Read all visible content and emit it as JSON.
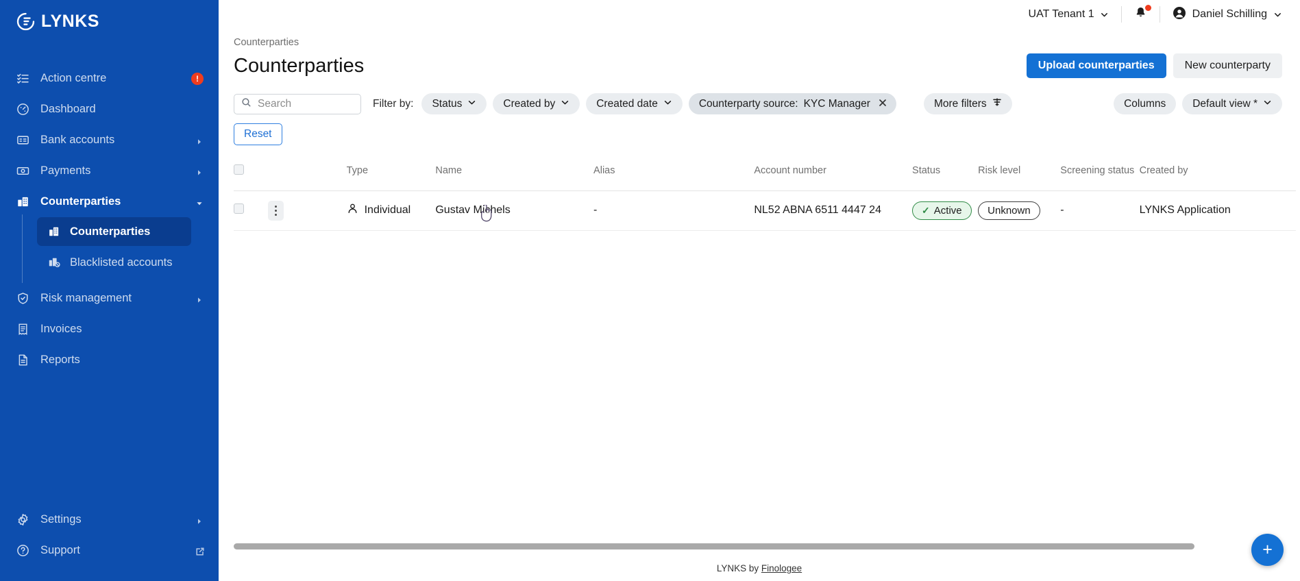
{
  "brand": {
    "name": "LYNKS",
    "logo_icon": "lynks-logo-icon",
    "accent": "#1471d4",
    "sidebar_bg": "#0d4eae",
    "sidebar_active_bg": "#0a3d8f"
  },
  "sidebar": {
    "items": [
      {
        "label": "Action centre",
        "icon": "action-list-icon",
        "badge": "!",
        "has_arrow": false
      },
      {
        "label": "Dashboard",
        "icon": "dashboard-gauge-icon",
        "has_arrow": false
      },
      {
        "label": "Bank accounts",
        "icon": "bank-card-icon",
        "has_arrow": true
      },
      {
        "label": "Payments",
        "icon": "banknote-icon",
        "has_arrow": true
      },
      {
        "label": "Counterparties",
        "icon": "building-icon",
        "has_arrow": true,
        "expanded": true
      },
      {
        "label": "Risk management",
        "icon": "shield-check-icon",
        "has_arrow": true
      },
      {
        "label": "Invoices",
        "icon": "invoice-icon",
        "has_arrow": false
      },
      {
        "label": "Reports",
        "icon": "document-icon",
        "has_arrow": false
      }
    ],
    "subitems": [
      {
        "label": "Counterparties",
        "icon": "building-icon",
        "selected": true
      },
      {
        "label": "Blacklisted accounts",
        "icon": "building-blocked-icon",
        "selected": false
      }
    ],
    "bottom_items": [
      {
        "label": "Settings",
        "icon": "gear-icon",
        "has_arrow": true
      },
      {
        "label": "Support",
        "icon": "help-circle-icon",
        "external": true,
        "external_icon": "external-link-icon"
      }
    ]
  },
  "topbar": {
    "tenant": "UAT Tenant 1",
    "tenant_chevron": "chevron-down-icon",
    "notifications_icon": "bell-icon",
    "has_notification_dot": true,
    "user_name": "Daniel Schilling",
    "user_icon": "user-avatar-icon",
    "user_chevron": "chevron-down-icon"
  },
  "page": {
    "breadcrumb": "Counterparties",
    "title": "Counterparties",
    "actions": {
      "primary": "Upload counterparties",
      "secondary": "New counterparty"
    }
  },
  "filters": {
    "search_placeholder": "Search",
    "search_value": "",
    "search_icon": "search-icon",
    "filter_by_label": "Filter by:",
    "chips": [
      {
        "label": "Status",
        "icon": "chevron-down-icon",
        "applied": false
      },
      {
        "label": "Created by",
        "icon": "chevron-down-icon",
        "applied": false
      },
      {
        "label": "Created date",
        "icon": "chevron-down-icon",
        "applied": false
      },
      {
        "label": "Counterparty source:",
        "value": "KYC Manager",
        "icon": "close-icon",
        "applied": true
      }
    ],
    "more_filters": {
      "label": "More filters",
      "icon": "filter-lines-icon"
    },
    "columns": {
      "label": "Columns"
    },
    "view": {
      "label": "Default view *",
      "icon": "chevron-down-icon"
    },
    "reset": "Reset"
  },
  "table": {
    "select_all_checkbox": false,
    "columns": [
      {
        "key": "checkbox",
        "label": ""
      },
      {
        "key": "kebab",
        "label": ""
      },
      {
        "key": "iconcol",
        "label": ""
      },
      {
        "key": "type",
        "label": "Type"
      },
      {
        "key": "name",
        "label": "Name"
      },
      {
        "key": "alias",
        "label": "Alias"
      },
      {
        "key": "account_number",
        "label": "Account number"
      },
      {
        "key": "status",
        "label": "Status"
      },
      {
        "key": "risk_level",
        "label": "Risk level"
      },
      {
        "key": "screening_status",
        "label": "Screening status"
      },
      {
        "key": "created_by",
        "label": "Created by"
      }
    ],
    "rows": [
      {
        "selected": false,
        "row_menu_icon": "kebab-menu-icon",
        "type_icon": "person-icon",
        "type": "Individual",
        "name": "Gustav Michels",
        "alias": "-",
        "account_number": "NL52 ABNA 6511 4447 24",
        "status": "Active",
        "status_icon": "check-icon",
        "risk_level": "Unknown",
        "screening_status": "-",
        "created_by": "LYNKS Application"
      }
    ]
  },
  "footer": {
    "text_prefix": "LYNKS by ",
    "link": "Finologee"
  },
  "fab": {
    "icon": "plus-icon",
    "label": "+"
  }
}
